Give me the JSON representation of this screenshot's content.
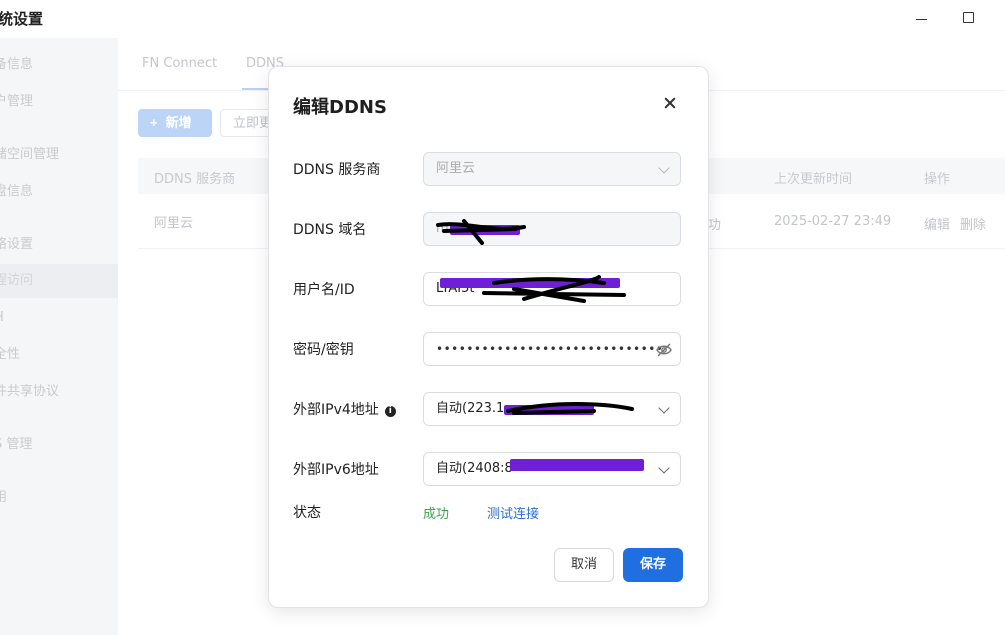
{
  "window": {
    "title": "统设置"
  },
  "sidebar": {
    "items": [
      {
        "label": "备信息"
      },
      {
        "label": "户管理"
      },
      {
        "label": "储空间管理"
      },
      {
        "label": "盘信息"
      },
      {
        "label": "络设置"
      },
      {
        "label": "程访问"
      },
      {
        "label": "H"
      },
      {
        "label": "全性"
      },
      {
        "label": "件共享协议"
      },
      {
        "label": "S 管理"
      },
      {
        "label": "用"
      }
    ]
  },
  "main": {
    "tabs": [
      {
        "label": "FN Connect"
      },
      {
        "label": "DDNS"
      }
    ],
    "add_button": "新增",
    "update_button": "立即更",
    "table": {
      "headers": {
        "provider": "DDNS 服务商",
        "last_update": "上次更新时间",
        "actions": "操作"
      },
      "row": {
        "provider": "阿里云",
        "status": "功",
        "last_update": "2025-02-27 23:49",
        "edit": "编辑",
        "delete": "删除"
      }
    }
  },
  "dialog": {
    "title": "编辑DDNS",
    "fields": {
      "provider": {
        "label": "DDNS 服务商",
        "value": "阿里云"
      },
      "domain": {
        "label": "DDNS 域名",
        "value": "m"
      },
      "username": {
        "label": "用户名/ID",
        "value": "LTAI5t"
      },
      "password": {
        "label": "密码/密钥",
        "value": "••••••••••••••••••••••••••••••"
      },
      "ipv4": {
        "label": "外部IPv4地址",
        "value": "自动(223.1"
      },
      "ipv6": {
        "label": "外部IPv6地址",
        "value": "自动(2408:8"
      },
      "status": {
        "label": "状态",
        "value": "成功",
        "test_link": "测试连接"
      }
    },
    "cancel_button": "取消",
    "save_button": "保存"
  },
  "colors": {
    "primary": "#1f6fe0",
    "success": "#3fa34d",
    "link": "#2b6fd6",
    "redaction": "#6f1fd6"
  }
}
